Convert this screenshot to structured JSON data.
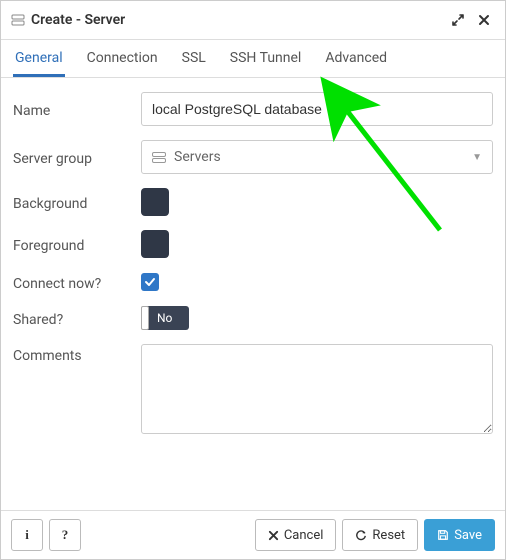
{
  "header": {
    "title": "Create - Server"
  },
  "tabs": [
    {
      "id": "general",
      "label": "General"
    },
    {
      "id": "connection",
      "label": "Connection"
    },
    {
      "id": "ssl",
      "label": "SSL"
    },
    {
      "id": "ssh",
      "label": "SSH Tunnel"
    },
    {
      "id": "advanced",
      "label": "Advanced"
    }
  ],
  "active_tab": "general",
  "form": {
    "name": {
      "label": "Name",
      "value": "local PostgreSQL database"
    },
    "server_group": {
      "label": "Server group",
      "selected": "Servers"
    },
    "background": {
      "label": "Background",
      "color": "#2f3746"
    },
    "foreground": {
      "label": "Foreground",
      "color": "#2f3746"
    },
    "connect_now": {
      "label": "Connect now?",
      "checked": true
    },
    "shared": {
      "label": "Shared?",
      "value": false,
      "display": "No"
    },
    "comments": {
      "label": "Comments",
      "value": ""
    }
  },
  "footer": {
    "info": "i",
    "help": "?",
    "cancel": "Cancel",
    "reset": "Reset",
    "save": "Save"
  }
}
